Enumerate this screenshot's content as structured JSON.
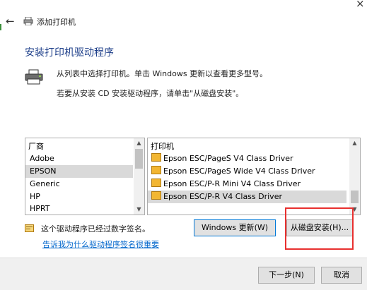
{
  "window": {
    "title": "添加打印机",
    "close_glyph": "×",
    "back_glyph": "←"
  },
  "page": {
    "heading": "安装打印机驱动程序",
    "description_1": "从列表中选择打印机。单击 Windows 更新以查看更多型号。",
    "description_2": "若要从安装 CD 安装驱动程序，请单击\"从磁盘安装\"。"
  },
  "manufacturers": {
    "header": "厂商",
    "items": [
      {
        "label": "Adobe"
      },
      {
        "label": "EPSON"
      },
      {
        "label": "Generic"
      },
      {
        "label": "HP"
      },
      {
        "label": "HPRT"
      }
    ],
    "selected": "EPSON"
  },
  "drivers": {
    "header": "打印机",
    "items": [
      {
        "label": "Epson ESC/PageS V4 Class Driver"
      },
      {
        "label": "Epson ESC/PageS Wide V4 Class Driver"
      },
      {
        "label": "Epson ESC/P-R Mini V4 Class Driver"
      },
      {
        "label": "Epson ESC/P-R V4 Class Driver"
      }
    ],
    "selected": "Epson ESC/P-R V4 Class Driver"
  },
  "signature": {
    "status": "这个驱动程序已经过数字签名。",
    "link": "告诉我为什么驱动程序签名很重要"
  },
  "buttons": {
    "windows_update": "Windows 更新(W)",
    "have_disk": "从磁盘安装(H)...",
    "next": "下一步(N)",
    "cancel": "取消"
  },
  "icons": {
    "back": "back-arrow-icon",
    "close": "close-icon",
    "printer": "printer-icon",
    "driver": "driver-icon",
    "signed": "certificate-icon"
  },
  "colors": {
    "accent": "#0078d7",
    "heading": "#1e3f8a",
    "highlight": "#e8302f",
    "link": "#0066cc"
  }
}
